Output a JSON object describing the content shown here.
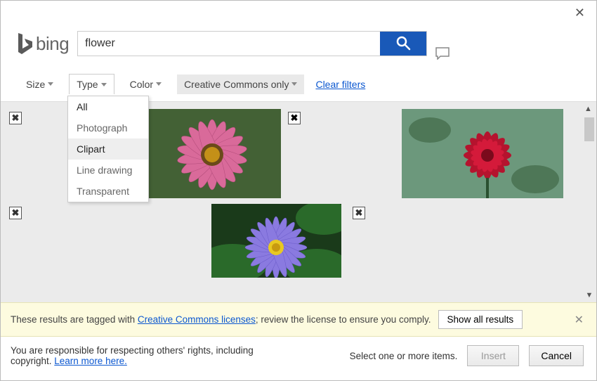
{
  "brand": {
    "name": "bing"
  },
  "search": {
    "value": "flower"
  },
  "filters": {
    "size": "Size",
    "type": "Type",
    "color": "Color",
    "license": "Creative Commons only",
    "clear": "Clear filters",
    "type_options": {
      "all": "All",
      "photograph": "Photograph",
      "clipart": "Clipart",
      "line_drawing": "Line drawing",
      "transparent": "Transparent"
    }
  },
  "notice": {
    "prefix": "These results are tagged with ",
    "link": "Creative Commons licenses",
    "suffix": "; review the license to ensure you comply.",
    "show_all": "Show all results"
  },
  "footer": {
    "text": "You are responsible for respecting others' rights, including copyright. ",
    "learn_more": "Learn more here.",
    "select_hint": "Select one or more items.",
    "insert": "Insert",
    "cancel": "Cancel"
  }
}
